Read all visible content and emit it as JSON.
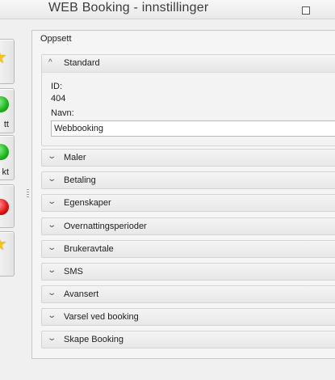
{
  "window": {
    "title": "WEB Booking - innstillinger"
  },
  "sidebar": {
    "buttons": [
      {
        "icon": "star-icon",
        "label": ""
      },
      {
        "icon": "green-circle-icon",
        "label": "tt"
      },
      {
        "icon": "green-circle-icon",
        "label": "kt"
      },
      {
        "icon": "red-circle-icon",
        "label": ""
      },
      {
        "icon": "star-icon",
        "label": ""
      }
    ]
  },
  "main": {
    "group_title": "Oppsett",
    "standard": {
      "title": "Standard",
      "id_label": "ID:",
      "id_value": "404",
      "name_label": "Navn:",
      "name_value": "Webbooking"
    },
    "panels": [
      {
        "title": "Maler"
      },
      {
        "title": "Betaling"
      },
      {
        "title": "Egenskaper"
      },
      {
        "title": "Overnattingsperioder"
      },
      {
        "title": "Brukeravtale"
      },
      {
        "title": "SMS"
      },
      {
        "title": "Avansert"
      },
      {
        "title": "Varsel ved booking"
      },
      {
        "title": "Skape Booking"
      }
    ]
  }
}
